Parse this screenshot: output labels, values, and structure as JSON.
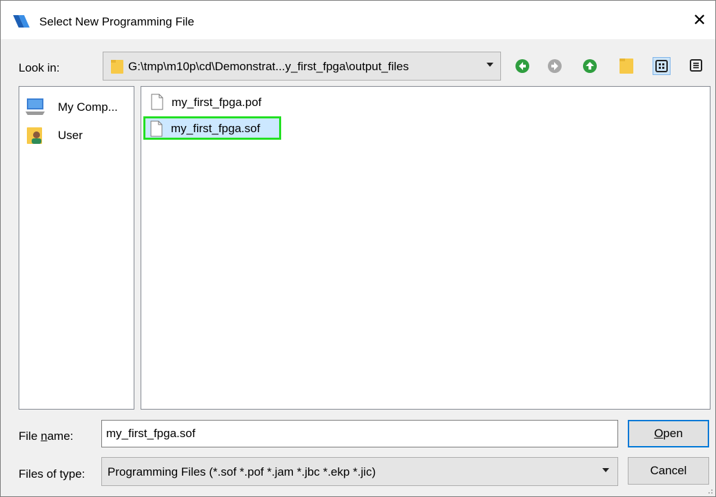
{
  "window": {
    "title": "Select New Programming File",
    "close_glyph": "✕"
  },
  "toolbar": {
    "look_in_label": "Look in:",
    "path": "G:\\tmp\\m10p\\cd\\Demonstrat...y_first_fpga\\output_files",
    "icons": [
      "back-icon",
      "forward-icon",
      "up-folder-icon",
      "new-folder-icon",
      "list-view-icon",
      "detail-view-icon"
    ]
  },
  "sidebar": {
    "items": [
      {
        "label": "My Comp...",
        "icon": "computer-icon"
      },
      {
        "label": "User",
        "icon": "user-folder-icon"
      }
    ]
  },
  "files": [
    {
      "name": "my_first_fpga.pof",
      "selected": false
    },
    {
      "name": "my_first_fpga.sof",
      "selected": true
    }
  ],
  "form": {
    "file_name_label_pre": "File ",
    "file_name_label_u": "n",
    "file_name_label_post": "ame:",
    "file_name_value": "my_first_fpga.sof",
    "files_of_type_label": "Files of type:",
    "files_of_type_value": "Programming Files (*.sof *.pof *.jam *.jbc *.ekp *.jic)"
  },
  "buttons": {
    "open_u": "O",
    "open_rest": "pen",
    "cancel": "Cancel"
  },
  "colors": {
    "accent": "#0078d7",
    "highlight": "#22e022",
    "selection": "#cce8ff",
    "nav_green": "#2f9e3f"
  }
}
